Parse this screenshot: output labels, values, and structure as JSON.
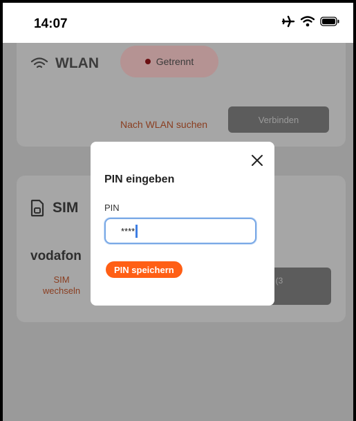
{
  "status_bar": {
    "time": "14:07",
    "icons": [
      "airplane-icon",
      "wifi-icon",
      "battery-icon"
    ]
  },
  "wlan_card": {
    "title": "WLAN",
    "icon": "wifi-icon",
    "status": "Getrennt",
    "status_color": "#6b0f12",
    "search_link": "Nach WLAN suchen",
    "connect_button": "Verbinden"
  },
  "sim_card": {
    "title": "SIM",
    "icon": "sim-card-icon",
    "provider": "vodafon",
    "change_link": "SIM\nwechseln",
    "action_button": "t (3\n)"
  },
  "modal": {
    "title": "PIN eingeben",
    "pin_label": "PIN",
    "pin_value": "****",
    "save_button": "PIN speichern",
    "close_icon": "close-icon"
  },
  "colors": {
    "accent": "#ff5f15",
    "input_focus": "#7aa9e6",
    "link": "#8a3d1f"
  }
}
